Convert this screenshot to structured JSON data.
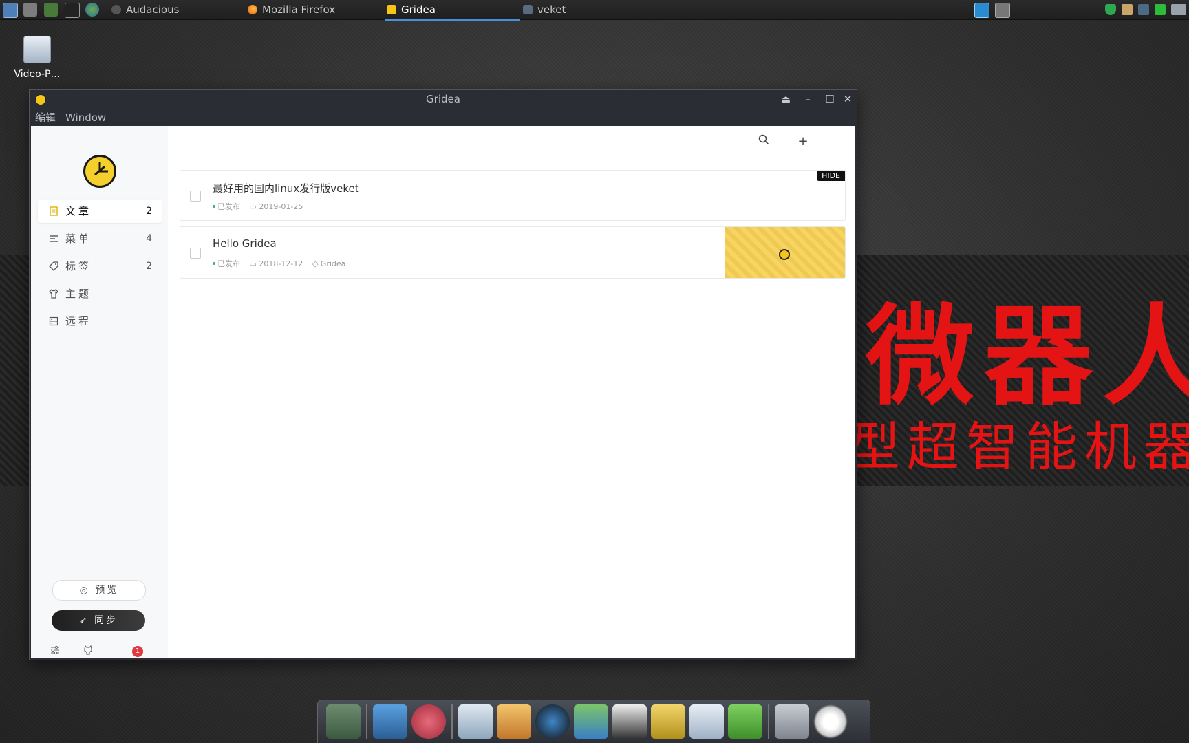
{
  "taskbar": {
    "tasks": [
      {
        "label": "Audacious"
      },
      {
        "label": "Mozilla Firefox"
      },
      {
        "label": "Gridea"
      },
      {
        "label": "veket"
      }
    ]
  },
  "desktop": {
    "icon_label": "Video-P…"
  },
  "banner": {
    "big_text": "微器人",
    "small_text": "型超智能机器"
  },
  "window": {
    "title": "Gridea",
    "menu": [
      "编辑",
      "Window"
    ]
  },
  "sidebar": {
    "items": [
      {
        "label": "文章",
        "count": "2",
        "icon": "document-icon"
      },
      {
        "label": "菜单",
        "count": "4",
        "icon": "menu-icon"
      },
      {
        "label": "标签",
        "count": "2",
        "icon": "tag-icon"
      },
      {
        "label": "主题",
        "count": "",
        "icon": "shirt-icon"
      },
      {
        "label": "远程",
        "count": "",
        "icon": "server-icon"
      }
    ],
    "preview_label": "预览",
    "sync_label": "同步",
    "badge_count": "1"
  },
  "posts": [
    {
      "title": "最好用的国内linux发行版veket",
      "status": "已发布",
      "date": "2019-01-25",
      "tag": "",
      "hidden_label": "HIDE"
    },
    {
      "title": "Hello Gridea",
      "status": "已发布",
      "date": "2018-12-12",
      "tag": "Gridea"
    }
  ],
  "toolbar": {
    "plus": "+"
  },
  "colors": {
    "accent": "#f5cf2c",
    "banner_red": "#e41414",
    "published_green": "#3db46d"
  }
}
